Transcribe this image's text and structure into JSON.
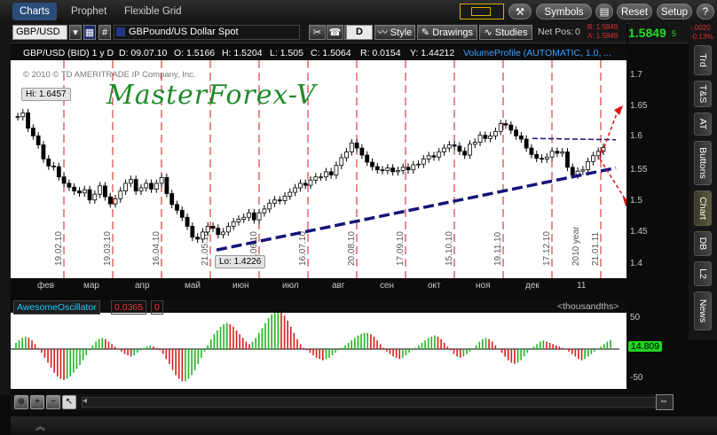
{
  "tabs": {
    "items": [
      "Charts",
      "Prophet",
      "Flexible Grid"
    ]
  },
  "topbar": {
    "symbols": "Symbols",
    "reset": "Reset",
    "setup": "Setup"
  },
  "toolbar": {
    "symbol": "GBP/USD",
    "hash": "#",
    "description": "GBPound/US Dollar Spot",
    "aggregation": "D",
    "style": "Style",
    "drawings": "Drawings",
    "studies": "Studies",
    "net_pos_label": "Net Pos:",
    "net_pos": "0",
    "bid": "B: 1.5849",
    "ask": "A: 1.5849",
    "last": "1.5849",
    "last_small": "5",
    "change": "-.0020",
    "change_pct": "-0.13%"
  },
  "infobar": {
    "title": "GBP/USD (BID) 1 y D",
    "d": "D: 09.07.10",
    "o": "O: 1.5166",
    "h": "H: 1.5204",
    "l": "L: 1.505",
    "c": "C: 1.5064",
    "r": "R: 0.0154",
    "y": "Y: 1.44212",
    "study": "VolumeProfile (AUTOMATIC, 1.0, ..."
  },
  "chart": {
    "copyright": "© 2010 © TD AMERITRADE IP Company, Inc.",
    "hi_label": "Hi: 1.6457",
    "lo_label": "Lo: 1.4226",
    "watermark": "MasterForex-V",
    "year_label": "2010 year",
    "date_lines": [
      "19.02.10",
      "19.03.10",
      "16.04.10",
      "21.05.10",
      "18.06.10",
      "16.07.10",
      "20.08.10",
      "17.09.10",
      "15.10.10",
      "19.11.10",
      "17.12.10",
      "21.01.11"
    ],
    "yticks": [
      "1.7",
      "1.65",
      "1.6",
      "1.55",
      "1.5",
      "1.45",
      "1.4"
    ],
    "months": [
      "фев",
      "мар",
      "апр",
      "май",
      "июн",
      "июл",
      "авг",
      "сен",
      "окт",
      "ноя",
      "дек",
      "11"
    ],
    "colors": {
      "candle": "#000000",
      "date_line": "#d01818",
      "trend": "#14147a",
      "target": "#e01010"
    }
  },
  "chart_data": {
    "type": "line",
    "title": "GBP/USD (BID) 1 y D",
    "ylim": [
      1.38,
      1.72
    ],
    "series": [
      {
        "values": [
          1.632,
          1.638,
          1.614,
          1.602,
          1.588,
          1.566,
          1.555,
          1.554,
          1.538,
          1.528,
          1.522,
          1.516,
          1.513,
          1.518,
          1.502,
          1.511,
          1.524,
          1.507,
          1.496,
          1.504,
          1.516,
          1.528,
          1.534,
          1.516,
          1.521,
          1.528,
          1.519,
          1.528,
          1.537,
          1.512,
          1.495,
          1.486,
          1.475,
          1.461,
          1.444,
          1.441,
          1.452,
          1.461,
          1.458,
          1.448,
          1.452,
          1.461,
          1.468,
          1.472,
          1.475,
          1.482,
          1.471,
          1.482,
          1.488,
          1.497,
          1.502,
          1.501,
          1.508,
          1.514,
          1.521,
          1.528,
          1.525,
          1.533,
          1.538,
          1.538,
          1.546,
          1.541,
          1.556,
          1.568,
          1.577,
          1.591,
          1.583,
          1.572,
          1.561,
          1.554,
          1.549,
          1.548,
          1.552,
          1.546,
          1.548,
          1.553,
          1.549,
          1.557,
          1.558,
          1.566,
          1.571,
          1.569,
          1.577,
          1.583,
          1.588,
          1.586,
          1.578,
          1.572,
          1.589,
          1.592,
          1.603,
          1.598,
          1.602,
          1.609,
          1.621,
          1.619,
          1.611,
          1.602,
          1.597,
          1.583,
          1.573,
          1.567,
          1.566,
          1.569,
          1.578,
          1.575,
          1.577,
          1.553,
          1.541,
          1.547,
          1.549,
          1.562,
          1.571,
          1.578,
          1.584
        ]
      }
    ]
  },
  "oscillator": {
    "name": "AwesomeOscillator",
    "value": "0.0365",
    "flag": "0",
    "units": "<thousandths>",
    "current": "14.809",
    "yticks": [
      "50",
      "0",
      "-50"
    ],
    "values": [
      10,
      14,
      18,
      20,
      18,
      14,
      8,
      2,
      -6,
      -14,
      -22,
      -30,
      -38,
      -44,
      -48,
      -50,
      -48,
      -44,
      -38,
      -32,
      -26,
      -18,
      -10,
      -2,
      6,
      12,
      16,
      18,
      16,
      12,
      8,
      4,
      0,
      -4,
      -8,
      -10,
      -12,
      -10,
      -6,
      -2,
      2,
      4,
      6,
      4,
      2,
      -2,
      -8,
      -16,
      -24,
      -34,
      -42,
      -48,
      -52,
      -52,
      -48,
      -42,
      -34,
      -24,
      -14,
      -4,
      6,
      16,
      24,
      30,
      36,
      40,
      42,
      40,
      36,
      30,
      24,
      18,
      12,
      8,
      12,
      18,
      26,
      34,
      42,
      50,
      56,
      60,
      62,
      60,
      54,
      46,
      36,
      26,
      16,
      8,
      2,
      -2,
      -6,
      -10,
      -14,
      -16,
      -18,
      -16,
      -14,
      -10,
      -6,
      -2,
      2,
      6,
      10,
      14,
      18,
      22,
      24,
      26,
      26,
      24,
      20,
      14,
      8,
      2,
      -4,
      -8,
      -12,
      -14,
      -16,
      -14,
      -10,
      -6,
      -2,
      2,
      6,
      10,
      14,
      18,
      20,
      22,
      20,
      16,
      10,
      4,
      -2,
      -8,
      -12,
      -14,
      -12,
      -8,
      -4,
      0,
      6,
      12,
      16,
      18,
      16,
      12,
      6,
      0,
      -6,
      -12,
      -18,
      -22,
      -24,
      -22,
      -18,
      -12,
      -6,
      0,
      4,
      8,
      12,
      14,
      12,
      10,
      8,
      6,
      4,
      2,
      0,
      -4,
      -8,
      -12,
      -16,
      -18,
      -16,
      -12,
      -8,
      -4,
      0,
      4,
      8,
      12,
      15
    ]
  },
  "sidebar": {
    "tabs": [
      "Trd",
      "T&S",
      "AT",
      "Buttons",
      "Chart",
      "DB",
      "L2",
      "News"
    ]
  }
}
